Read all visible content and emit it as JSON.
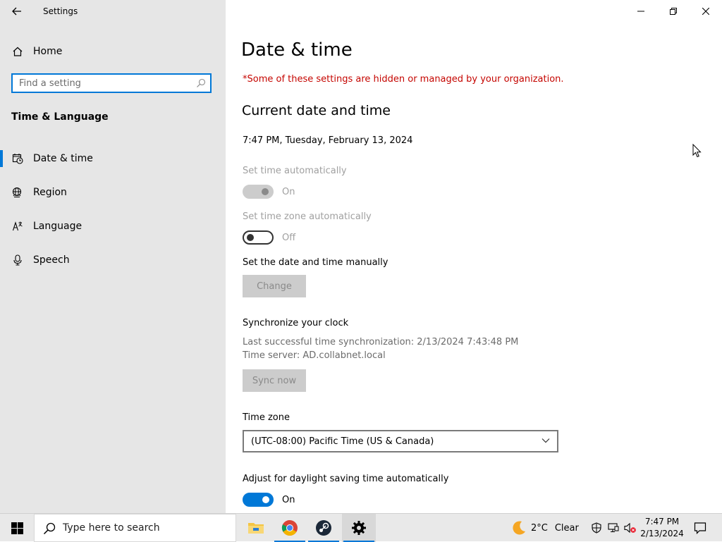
{
  "window": {
    "app_title": "Settings"
  },
  "sidebar": {
    "home_label": "Home",
    "search_placeholder": "Find a setting",
    "section_heading": "Time & Language",
    "items": [
      {
        "label": "Date & time",
        "icon": "clock-calendar-icon",
        "selected": true
      },
      {
        "label": "Region",
        "icon": "globe-icon",
        "selected": false
      },
      {
        "label": "Language",
        "icon": "language-icon",
        "selected": false
      },
      {
        "label": "Speech",
        "icon": "microphone-icon",
        "selected": false
      }
    ]
  },
  "main": {
    "page_title": "Date & time",
    "org_warning": "*Some of these settings are hidden or managed by your organization.",
    "current_heading": "Current date and time",
    "current_datetime": "7:47 PM, Tuesday, February 13, 2024",
    "set_time_auto": {
      "label": "Set time automatically",
      "state": "On"
    },
    "set_timezone_auto": {
      "label": "Set time zone automatically",
      "state": "Off"
    },
    "manual": {
      "label": "Set the date and time manually",
      "button": "Change"
    },
    "sync": {
      "heading": "Synchronize your clock",
      "last_sync": "Last successful time synchronization: 2/13/2024 7:43:48 PM",
      "server": "Time server: AD.collabnet.local",
      "button": "Sync now"
    },
    "timezone": {
      "label": "Time zone",
      "value": "(UTC-08:00) Pacific Time (US & Canada)"
    },
    "dst": {
      "label": "Adjust for daylight saving time automatically",
      "state": "On"
    }
  },
  "taskbar": {
    "search_placeholder": "Type here to search",
    "weather": {
      "temp": "2°C",
      "condition": "Clear"
    },
    "clock": {
      "time": "7:47 PM",
      "date": "2/13/2024"
    }
  },
  "colors": {
    "accent": "#0078d7",
    "warning": "#c50500",
    "sidebar_bg": "#e6e6e6"
  }
}
